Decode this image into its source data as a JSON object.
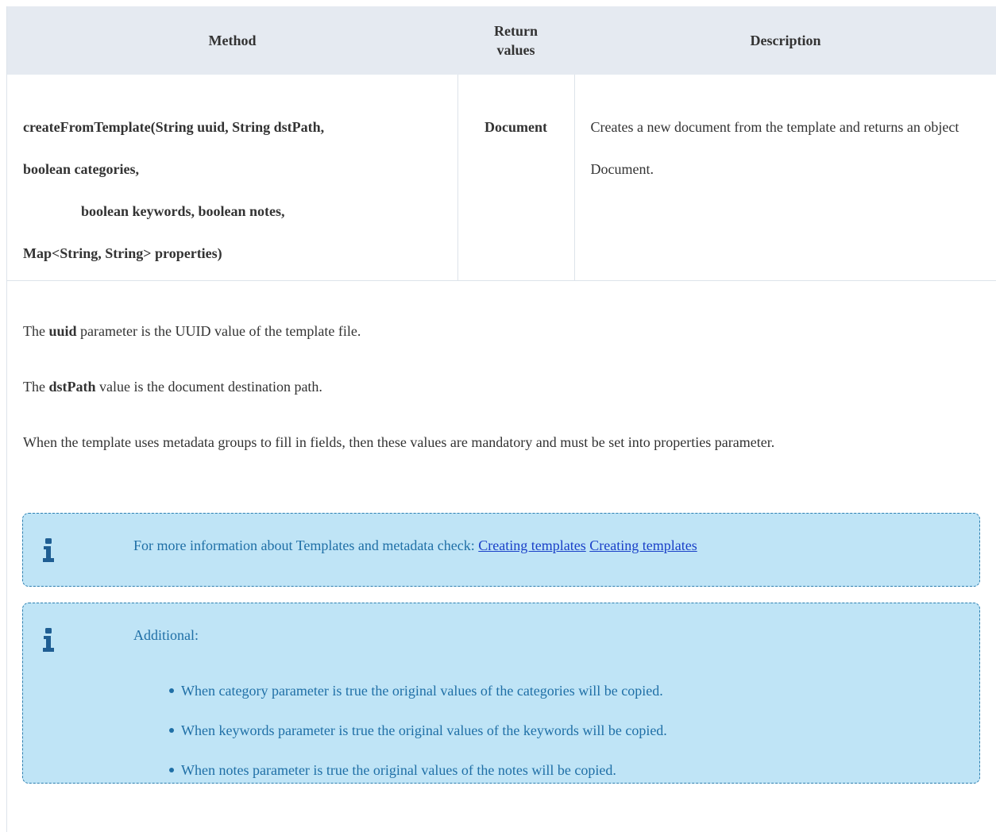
{
  "table": {
    "headers": {
      "method": "Method",
      "return_values": "Return values",
      "description": "Description"
    },
    "rows": [
      {
        "method_lines": [
          "createFromTemplate(String uuid, String dstPath,",
          "boolean categories,",
          "boolean keywords, boolean notes,",
          "Map<String, String> properties)"
        ],
        "return_value": "Document",
        "description": "Creates a new document from the template and returns an object Document."
      }
    ]
  },
  "paragraphs": {
    "uuid": {
      "prefix": "The",
      "term": "uuid",
      "suffix": "parameter is the UUID value of the template file."
    },
    "dstpath": {
      "prefix": "The",
      "term": "dstPath",
      "suffix": "value is the document destination path."
    },
    "metadata": "When the template uses metadata groups to fill in fields, then these values are mandatory and must be set into properties parameter."
  },
  "info_boxes": [
    {
      "icon": "info-icon",
      "text": "For more information about Templates and metadata check:",
      "links": [
        "Creating templates",
        "Creating templates"
      ]
    },
    {
      "icon": "info-icon",
      "title": "Additional:",
      "items": [
        "When category parameter is true the original values of the categories will be copied.",
        "When keywords parameter is true the original values of the keywords will be copied.",
        "When notes parameter is true the original values of the notes will be copied."
      ]
    }
  ],
  "colors": {
    "header_bg": "#e5eaf1",
    "info_bg": "#bfe4f6",
    "info_border": "#2d7fb0",
    "info_text": "#1f6fa6",
    "link": "#1a40c8"
  }
}
